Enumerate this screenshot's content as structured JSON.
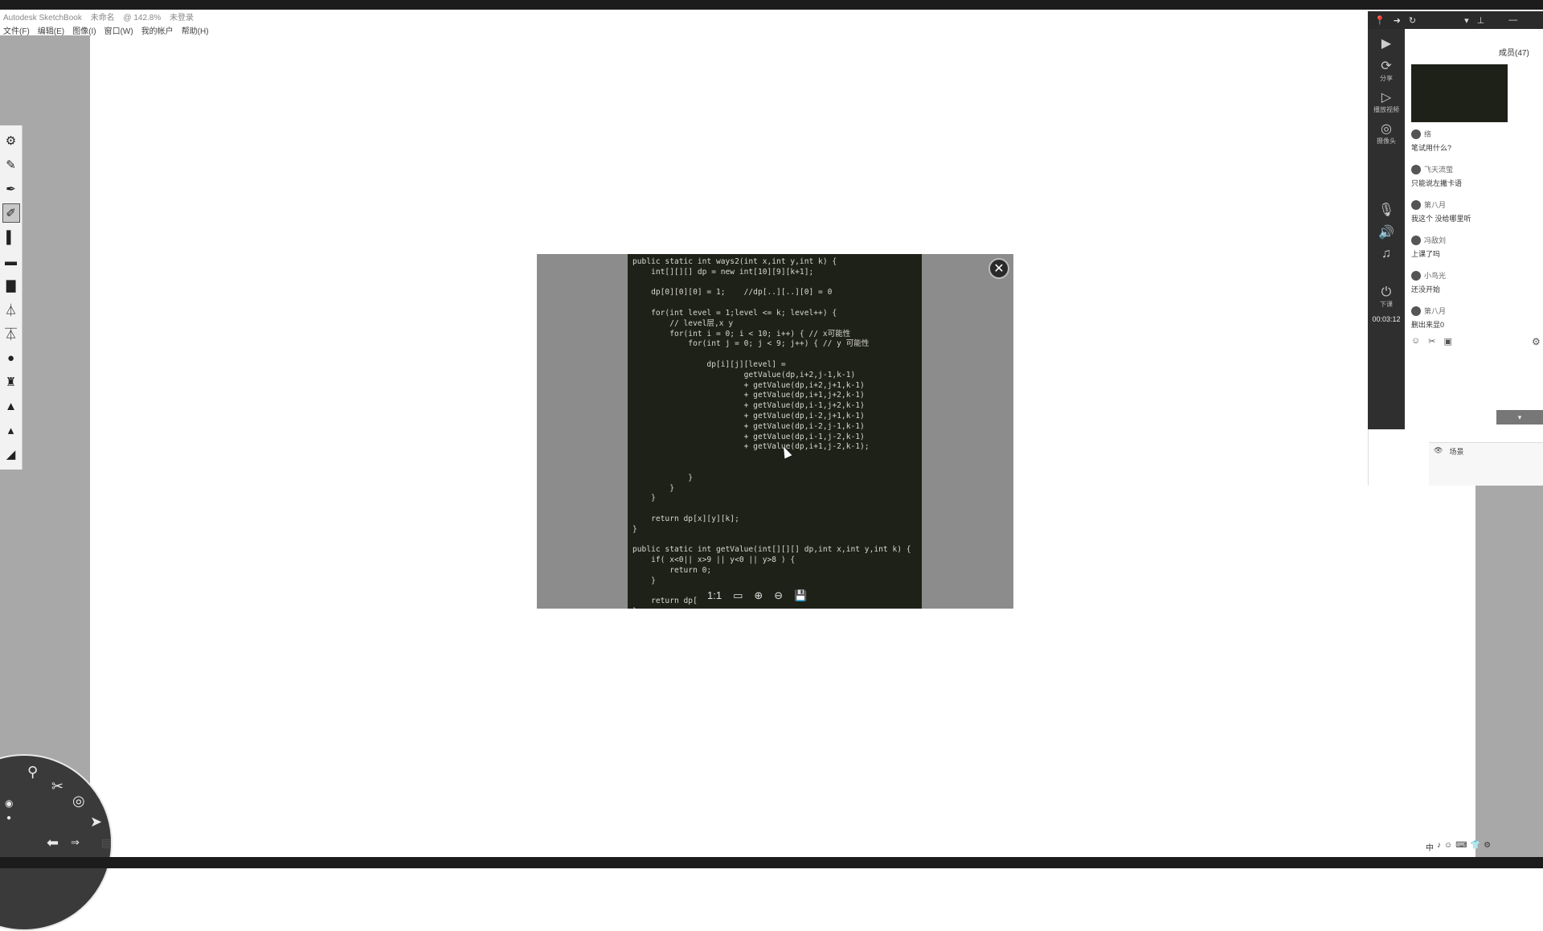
{
  "app": {
    "title": "Autodesk SketchBook",
    "doc_name": "未命名",
    "zoom": "@ 142.8%",
    "status": "未登录"
  },
  "menu": [
    "文件(F)",
    "编辑(E)",
    "图像(I)",
    "窗口(W)",
    "我的帐户",
    "帮助(H)"
  ],
  "viewer": {
    "code": "public static int ways2(int x,int y,int k) {\n    int[][][] dp = new int[10][9][k+1];\n\n    dp[0][0][0] = 1;    //dp[..][..][0] = 0\n\n    for(int level = 1;level <= k; level++) {\n        // level层,x y\n        for(int i = 0; i < 10; i++) { // x可能性\n            for(int j = 0; j < 9; j++) { // y 可能性\n\n                dp[i][j][level] =\n                        getValue(dp,i+2,j-1,k-1)\n                        + getValue(dp,i+2,j+1,k-1)\n                        + getValue(dp,i+1,j+2,k-1)\n                        + getValue(dp,i-1,j+2,k-1)\n                        + getValue(dp,i-2,j+1,k-1)\n                        + getValue(dp,i-2,j-1,k-1)\n                        + getValue(dp,i-1,j-2,k-1)\n                        + getValue(dp,i+1,j-2,k-1);\n\n\n            }\n        }\n    }\n\n    return dp[x][y][k];\n}\n\npublic static int getValue(int[][][] dp,int x,int y,int k) {\n    if( x<0|| x>9 || y<0 || y>8 ) {\n        return 0;\n    }\n\n    return dp[\n}",
    "close_icon": "✕",
    "tools": [
      "1:1",
      "▭",
      "⊕",
      "⊖",
      "💾"
    ]
  },
  "live": {
    "members_label": "成员(47)",
    "timer": "00:03:12",
    "side_labels": [
      "分享",
      "播放视频",
      "摄像头",
      "下课"
    ],
    "chat": [
      {
        "user": "络",
        "text": "笔试用什么?"
      },
      {
        "user": "飞天流萤",
        "text": "只能说左撇卡语"
      },
      {
        "user": "第八月",
        "text": "我这个 没给哪里听"
      },
      {
        "user": "冯敌刘",
        "text": "上课了吗"
      },
      {
        "user": "小鸟光",
        "text": "还没开始"
      },
      {
        "user": "第八月",
        "text": "删出来显0"
      }
    ],
    "scene_label": "场景"
  },
  "tray": [
    "中",
    "♪",
    "☺",
    "⌨",
    "👕",
    "⚙"
  ]
}
